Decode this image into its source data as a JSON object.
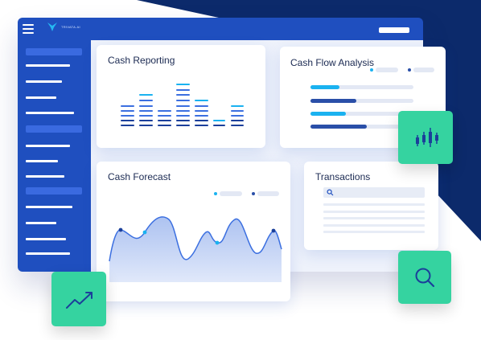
{
  "app": {
    "logo_text": "TRIVATA.AI"
  },
  "cards": {
    "cash_reporting": {
      "title": "Cash Reporting"
    },
    "cash_flow_analysis": {
      "title": "Cash Flow Analysis"
    },
    "cash_forecast": {
      "title": "Cash Forecast"
    },
    "transactions": {
      "title": "Transactions"
    }
  },
  "icons": {
    "menu": "menu-icon",
    "logo": "trovata-logo-icon",
    "chart": "candlestick-chart-icon",
    "search": "search-icon",
    "trend": "trending-up-icon"
  },
  "colors": {
    "brand_blue": "#1f4fbf",
    "accent_cyan": "#1ab2f0",
    "dark_navy": "#0d2a6e",
    "green": "#35d3a0",
    "bar_blue": "#3b6fe0"
  }
}
